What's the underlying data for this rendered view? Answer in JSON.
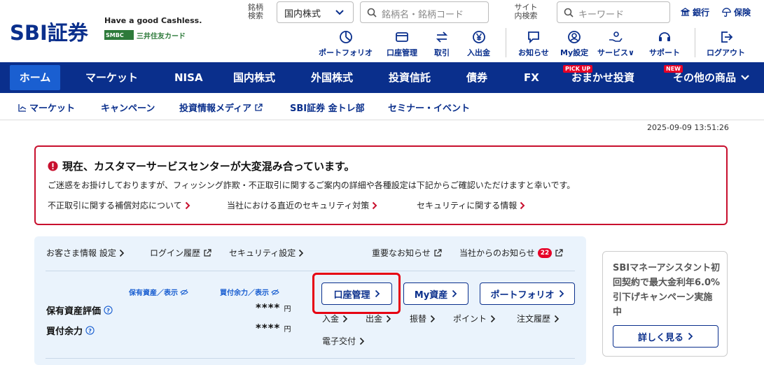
{
  "header": {
    "logo": "SBI証券",
    "tagline": "Have a good Cashless.",
    "partner_badge": "SMBC",
    "partner_text": "三井住友カード",
    "stock_search_label": "銘柄検索",
    "market_select_value": "国内株式",
    "stock_search_placeholder": "銘柄名・銘柄コード",
    "site_search_label": "サイト内検索",
    "keyword_placeholder": "キーワード",
    "bank_link": "銀行",
    "insurance_link": "保険",
    "icon_links": {
      "portfolio": "ポートフォリオ",
      "account": "口座管理",
      "trade": "取引",
      "deposit": "入出金",
      "notices": "お知らせ",
      "my_settings": "My設定",
      "services": "サービス",
      "support": "サポート",
      "logout": "ログアウト"
    }
  },
  "mainnav": {
    "home": "ホーム",
    "market": "マーケット",
    "nisa": "NISA",
    "domestic": "国内株式",
    "foreign": "外国株式",
    "funds": "投資信託",
    "bonds": "債券",
    "fx": "FX",
    "omakase": "おまかせ投資",
    "omakase_tag": "PICK UP",
    "other": "その他の商品",
    "other_tag": "NEW"
  },
  "subnav": {
    "market": "マーケット",
    "campaign": "キャンペーン",
    "media": "投資情報メディア",
    "kintore": "SBI証券 金トレ部",
    "seminar": "セミナー・イベント"
  },
  "timestamp": "2025-09-09 13:51:26",
  "alert": {
    "title": "現在、カスタマーサービスセンターが大変混み合っています。",
    "body": "ご迷惑をお掛けしておりますが、フィッシング詐欺・不正取引に関するご案内の詳細や各種設定は下記からご確認いただけますと幸いです。",
    "link1": "不正取引に関する補償対応について",
    "link2": "当社における直近のセキュリティ対策",
    "link3": "セキュリティに関する情報"
  },
  "account": {
    "customer_info": "お客さま情報 設定",
    "login_history": "ログイン履歴",
    "security_settings": "セキュリティ設定",
    "important_notices": "重要なお知らせ",
    "company_notices": "当社からのお知らせ",
    "notice_count": "22",
    "assets_toggle": "保有資産／表示",
    "buying_toggle": "買付余力／表示",
    "asset_value_label": "保有資産評価",
    "buying_power_label": "買付余力",
    "masked_value": "****",
    "yen": "円",
    "btn_account": "口座管理",
    "btn_my_assets": "My資産",
    "btn_portfolio": "ポートフォリオ",
    "deposit": "入金",
    "withdraw": "出金",
    "transfer": "振替",
    "points": "ポイント",
    "order_history": "注文履歴",
    "e_delivery": "電子交付"
  },
  "promo": {
    "text": "SBIマネーアシスタント初回契約で最大金利年6.0%引下げキャンペーン実施中",
    "button": "詳しく見る"
  },
  "colors": {
    "brand": "#0a2f8c",
    "accent": "#1a5fd1",
    "alert": "#c8102e",
    "panel_bg": "#eaf3fc"
  }
}
